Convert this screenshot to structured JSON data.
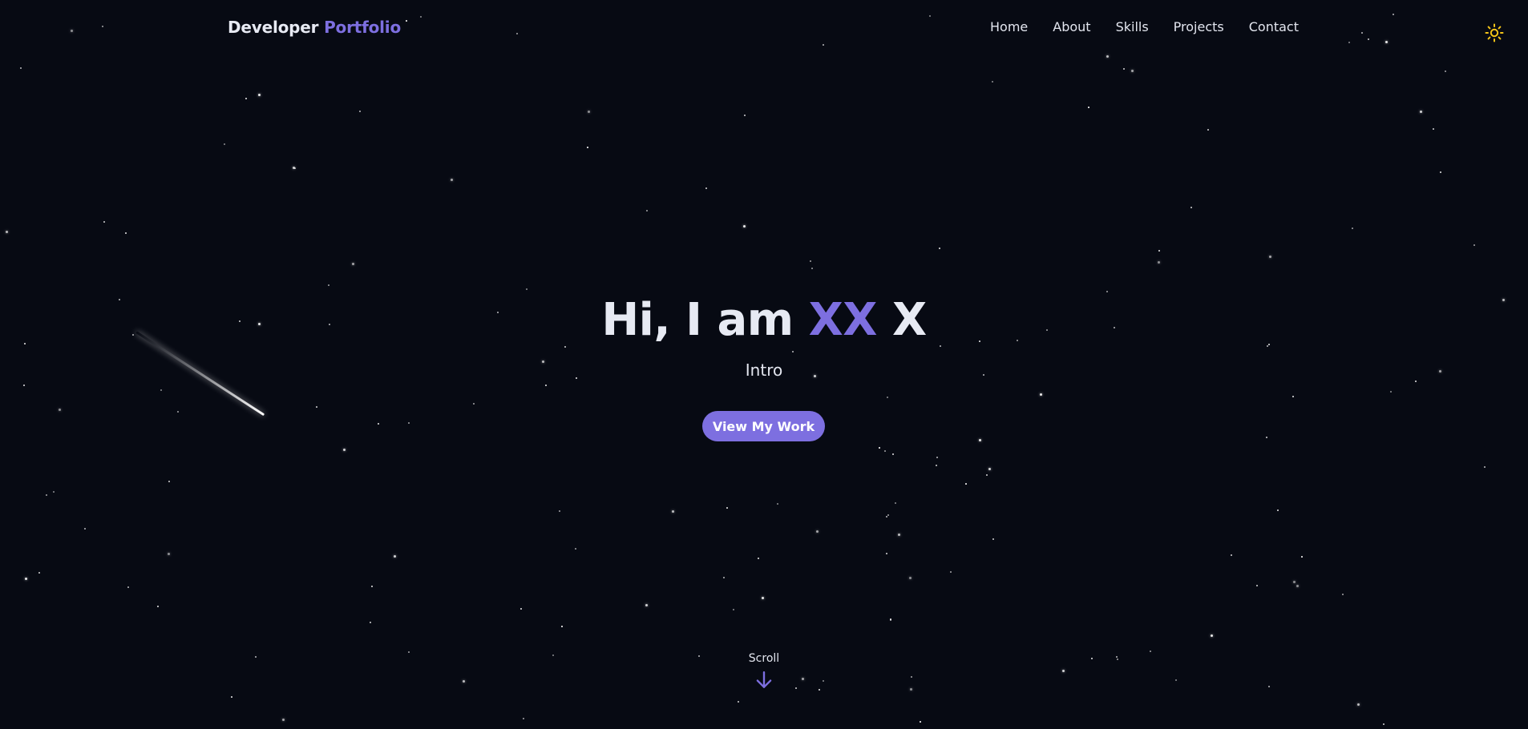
{
  "header": {
    "logo_part1": "Developer",
    "logo_part2": "Portfolio",
    "nav": [
      "Home",
      "About",
      "Skills",
      "Projects",
      "Contact"
    ],
    "theme_toggle_icon": "sun-icon",
    "theme_toggle_color": "#f5c518"
  },
  "hero": {
    "greeting": "Hi, I am",
    "name_accent": "XX",
    "name_rest": "X",
    "subtitle": "Intro",
    "cta_label": "View My Work"
  },
  "scroll": {
    "label": "Scroll",
    "icon": "arrow-down-icon"
  },
  "colors": {
    "background": "#070a13",
    "accent": "#7d6fe0",
    "text": "#e7eaf3",
    "sun": "#f5c518"
  }
}
